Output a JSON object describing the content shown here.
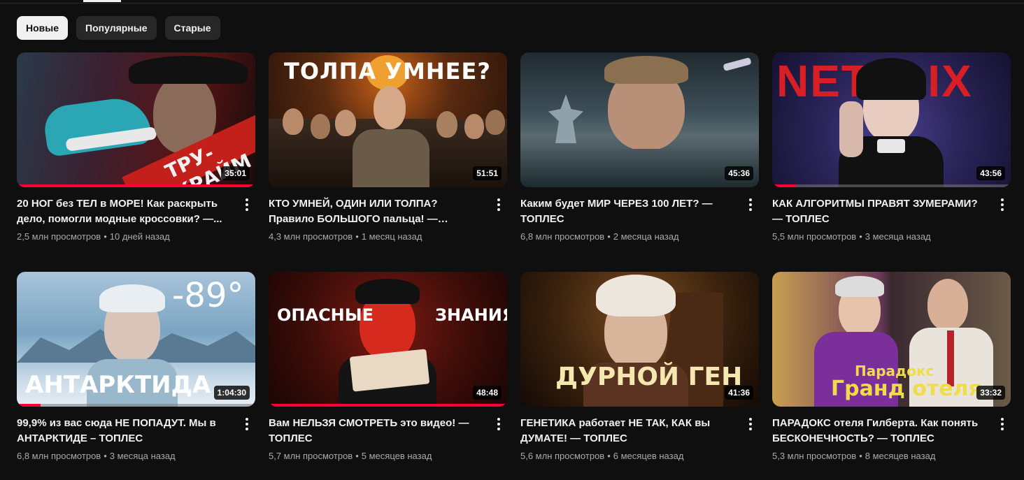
{
  "chips": [
    {
      "label": "Новые",
      "selected": true
    },
    {
      "label": "Популярные",
      "selected": false
    },
    {
      "label": "Старые",
      "selected": false
    }
  ],
  "videos": [
    {
      "title": "20 НОГ без ТЕЛ в МОРЕ! Как раскрыть дело, помогли модные кроссовки? —...",
      "views": "2,5 млн просмотров",
      "age": "10 дней назад",
      "duration": "35:01",
      "thumb_text": "ТРУ-КРАЙМ",
      "watched": 1.0,
      "palette": [
        "#3a1010",
        "#b3201c",
        "#2aa6b4"
      ]
    },
    {
      "title": "КТО УМНЕЙ, ОДИН ИЛИ ТОЛПА? Правило БОЛЬШОГО пальца! — ТОПЛЕС",
      "views": "4,3 млн просмотров",
      "age": "1 месяц назад",
      "duration": "51:51",
      "thumb_text": "ТОЛПА УМНЕЕ?",
      "watched": 0,
      "palette": [
        "#2a1208",
        "#7a3a12",
        "#f0a030"
      ]
    },
    {
      "title": "Каким будет МИР ЧЕРЕЗ 100 ЛЕТ? — ТОПЛЕС",
      "views": "6,8 млн просмотров",
      "age": "2 месяца назад",
      "duration": "45:36",
      "thumb_text": "",
      "watched": 0,
      "palette": [
        "#1b2226",
        "#3e4f58",
        "#8fa2aa"
      ]
    },
    {
      "title": "КАК АЛГОРИТМЫ ПРАВЯТ ЗУМЕРАМИ? — ТОПЛЕС",
      "views": "5,5 млн просмотров",
      "age": "3 месяца назад",
      "duration": "43:56",
      "thumb_text": "NETFLIX",
      "watched": 0.1,
      "palette": [
        "#1e1c3a",
        "#3a2f6e",
        "#d81f26"
      ]
    },
    {
      "title": "99,9% из вас сюда НЕ ПОПАДУТ. Мы в АНТАРКТИДЕ – ТОПЛЕС",
      "views": "6,8 млн просмотров",
      "age": "3 месяца назад",
      "duration": "1:04:30",
      "thumb_text": "АНТАРКТИДА",
      "thumb_text2": "-89°",
      "watched": 0.1,
      "palette": [
        "#2a4a66",
        "#7aa4c2",
        "#d9e8f2"
      ]
    },
    {
      "title": "Вам НЕЛЬЗЯ СМОТРЕТЬ это видео! — ТОПЛЕС",
      "views": "5,7 млн просмотров",
      "age": "5 месяцев назад",
      "duration": "48:48",
      "thumb_text": "ОПАСНЫЕ",
      "thumb_text2": "ЗНАНИЯ",
      "watched": 1.0,
      "palette": [
        "#300808",
        "#8a1410",
        "#e33a22"
      ]
    },
    {
      "title": "ГЕНЕТИКА работает НЕ ТАК, КАК вы ДУМАТЕ! — ТОПЛЕС",
      "views": "5,6 млн просмотров",
      "age": "6 месяцев назад",
      "duration": "41:36",
      "thumb_text": "ДУРНОЙ ГЕН",
      "watched": 0,
      "palette": [
        "#1e1208",
        "#5a3518",
        "#c98a3a"
      ]
    },
    {
      "title": "ПАРАДОКС отеля Гилберта. Как понять БЕСКОНЕЧНОСТЬ? — ТОПЛЕС",
      "views": "5,3 млн просмотров",
      "age": "8 месяцев назад",
      "duration": "33:32",
      "thumb_text": "Парадокс",
      "thumb_text2": "Гранд отеля",
      "watched": 0,
      "palette": [
        "#3a1e4a",
        "#7a3f8a",
        "#e8d24a"
      ]
    }
  ]
}
